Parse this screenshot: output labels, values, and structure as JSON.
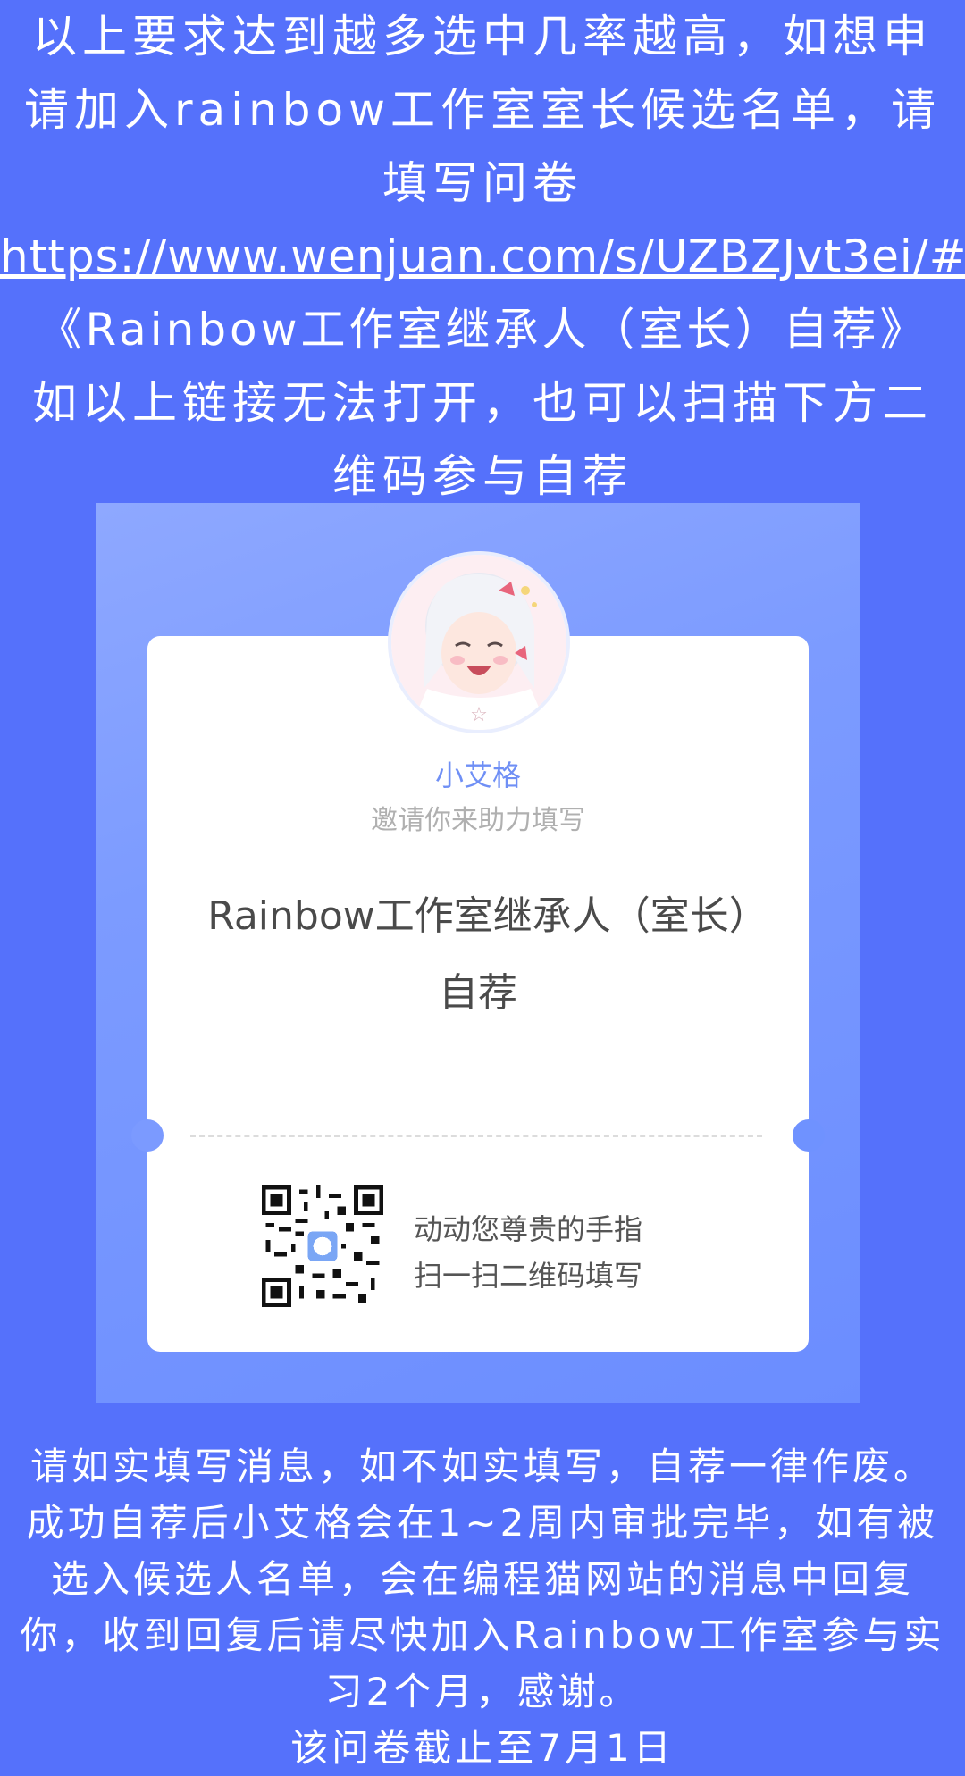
{
  "intro": {
    "requirement_text": "以上要求达到越多选中几率越高，如想申请加入rainbow工作室室长候选名单，请填写问卷",
    "link": "https://www.wenjuan.com/s/UZBZJvt3ei/#",
    "survey_ref": "《Rainbow工作室继承人（室长）自荐》",
    "qr_hint": "如以上链接无法打开，也可以扫描下方二维码参与自荐"
  },
  "poster": {
    "inviter_name": "小艾格",
    "invite_text": "邀请你来助力填写",
    "survey_title": "Rainbow工作室继承人（室长）自荐",
    "qr_caption_line1": "动动您尊贵的手指",
    "qr_caption_line2": "扫一扫二维码填写",
    "avatar_icon": "anime-girl-avatar",
    "qr_icon": "qr-code-icon"
  },
  "outro": {
    "notice": "请如实填写消息，如不如实填写，自荐一律作废。成功自荐后小艾格会在1~2周内审批完毕，如有被选入候选人名单，会在编程猫网站的消息中回复你，收到回复后请尽快加入Rainbow工作室参与实习2个月，感谢。",
    "deadline": "该问卷截止至7月1日"
  },
  "colors": {
    "background": "#5571fb",
    "poster_gradient_start": "#8ea8ff",
    "poster_gradient_end": "#6b8dff",
    "card": "#ffffff",
    "inviter_accent": "#6f8ff5"
  }
}
